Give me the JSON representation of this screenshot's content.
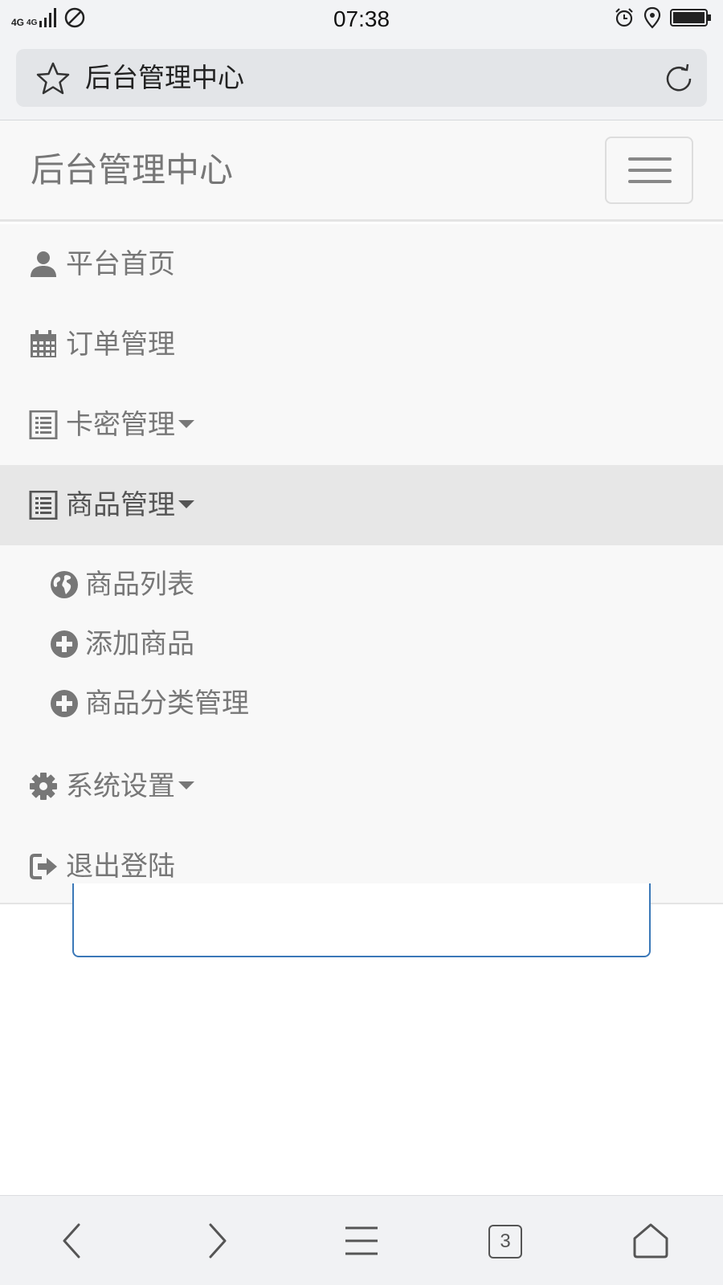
{
  "status_bar": {
    "signal_text_1": "4G",
    "signal_text_2": "4G",
    "time": "07:38",
    "icons": [
      "signal-icon",
      "no-disturb-icon",
      "alarm-icon",
      "location-icon",
      "battery-icon"
    ]
  },
  "browser": {
    "page_title": "后台管理中心",
    "icons": [
      "star-icon",
      "reload-icon"
    ],
    "toolbar": {
      "tab_count": "3",
      "icons": [
        "back-icon",
        "forward-icon",
        "menu-icon",
        "tabs-icon",
        "home-icon"
      ]
    }
  },
  "navbar": {
    "brand": "后台管理中心",
    "toggle_icon": "hamburger-icon"
  },
  "menu": {
    "items": [
      {
        "label": "平台首页",
        "icon": "user-icon",
        "dropdown": false,
        "active": false
      },
      {
        "label": "订单管理",
        "icon": "calendar-icon",
        "dropdown": false,
        "active": false
      },
      {
        "label": "卡密管理",
        "icon": "list-icon",
        "dropdown": true,
        "active": false
      },
      {
        "label": "商品管理",
        "icon": "list-icon",
        "dropdown": true,
        "active": true
      },
      {
        "label": "系统设置",
        "icon": "gear-icon",
        "dropdown": true,
        "active": false
      },
      {
        "label": "退出登陆",
        "icon": "logout-icon",
        "dropdown": false,
        "active": false
      }
    ],
    "submenu": [
      {
        "label": "商品列表",
        "icon": "globe-icon"
      },
      {
        "label": "添加商品",
        "icon": "plus-circle-icon"
      },
      {
        "label": "商品分类管理",
        "icon": "plus-circle-icon"
      }
    ]
  },
  "colors": {
    "navbar_bg": "#f8f8f8",
    "active_item_bg": "#e7e7e7",
    "menu_text": "#777777",
    "input_border": "#3b78b8"
  }
}
